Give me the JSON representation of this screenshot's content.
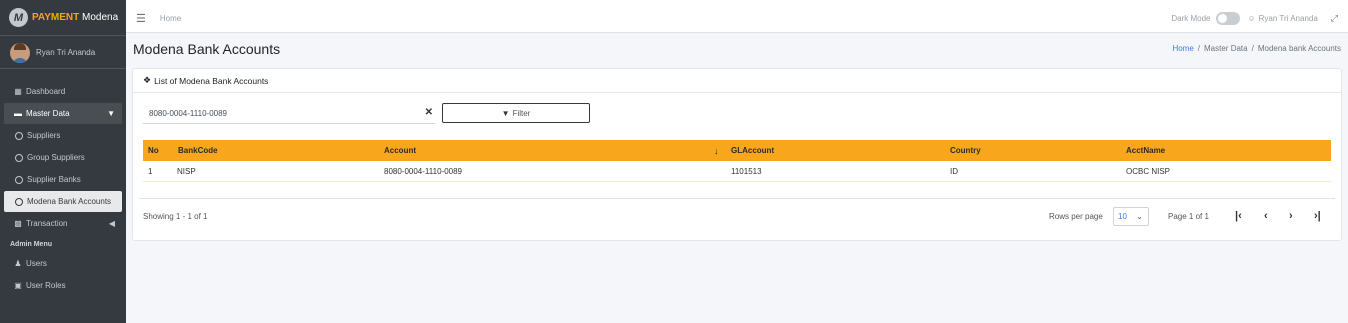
{
  "brand": {
    "logo_letter": "M",
    "name_strong": "PAYMENT",
    "name_rest": "Modena"
  },
  "user": {
    "name": "Ryan Tri Ananda"
  },
  "sidebar": {
    "items": [
      {
        "label": "Dashboard",
        "icon": "grid-icon"
      },
      {
        "label": "Master Data",
        "icon": "drive-icon"
      },
      {
        "label": "Suppliers"
      },
      {
        "label": "Group Suppliers"
      },
      {
        "label": "Supplier Banks"
      },
      {
        "label": "Modena Bank Accounts"
      },
      {
        "label": "Transaction",
        "icon": "card-icon"
      }
    ],
    "admin_header": "Admin Menu",
    "admin_items": [
      {
        "label": "Users",
        "icon": "users-icon"
      },
      {
        "label": "User Roles",
        "icon": "lock-icon"
      }
    ]
  },
  "topbar": {
    "home": "Home",
    "dark_mode": "Dark Mode",
    "user": "Ryan Tri Ananda"
  },
  "page": {
    "title": "Modena Bank Accounts"
  },
  "breadcrumb": {
    "home": "Home",
    "master": "Master Data",
    "current": "Modena bank Accounts"
  },
  "card": {
    "header": "List of Modena Bank Accounts"
  },
  "search": {
    "value": "8080-0004-1110-0089"
  },
  "filter": {
    "label": "Filter"
  },
  "table": {
    "columns": [
      "No",
      "BankCode",
      "Account",
      "GLAccount",
      "Country",
      "AcctName"
    ],
    "rows": [
      [
        "1",
        "NISP",
        "8080-0004-1110-0089",
        "1101513",
        "ID",
        "OCBC NISP"
      ]
    ]
  },
  "footer": {
    "showing": "Showing 1 - 1 of 1",
    "rows_label": "Rows per page",
    "rows_value": "10",
    "page_of": "Page 1 of 1"
  },
  "colors": {
    "accent": "#f8a71c",
    "sidebar": "#343a40",
    "link": "#3f7fd4"
  }
}
